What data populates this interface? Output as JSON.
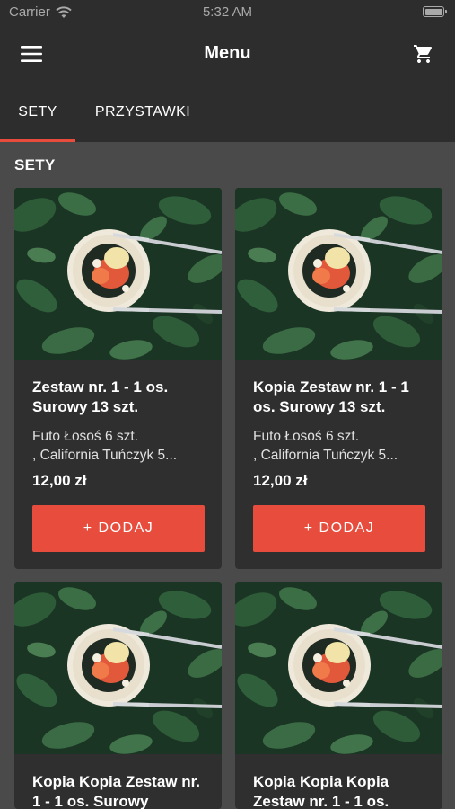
{
  "status_bar": {
    "carrier": "Carrier",
    "time": "5:32 AM"
  },
  "app_bar": {
    "title": "Menu",
    "menu_icon": "hamburger-menu-icon",
    "cart_icon": "shopping-cart-icon"
  },
  "tabs": [
    {
      "label": "SETY",
      "active": true
    },
    {
      "label": "PRZYSTAWKI",
      "active": false
    }
  ],
  "section": {
    "title": "SETY"
  },
  "products": [
    {
      "name": "Zestaw nr. 1 - 1 os. Surowy 13 szt.",
      "description": "Futo Łosoś 6 szt.\n, California Tuńczyk 5...",
      "price": "12,00 zł",
      "button": "+ DODAJ"
    },
    {
      "name": "Kopia Zestaw nr. 1 - 1 os. Surowy 13 szt.",
      "description": "Futo Łosoś 6 szt.\n, California Tuńczyk 5...",
      "price": "12,00 zł",
      "button": "+ DODAJ"
    },
    {
      "name": "Kopia Kopia Zestaw nr. 1 - 1 os. Surowy",
      "description": "",
      "price": "",
      "button": ""
    },
    {
      "name": "Kopia Kopia Kopia Zestaw nr. 1 - 1 os.",
      "description": "",
      "price": "",
      "button": ""
    }
  ],
  "colors": {
    "accent": "#e74c3c",
    "bar_background": "#2d2d2d",
    "page_background": "#4a4a4a",
    "card_background": "#2f2f2f"
  }
}
